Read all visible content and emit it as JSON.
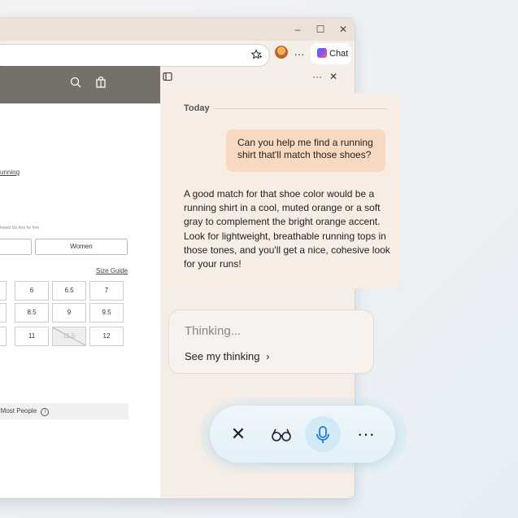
{
  "window": {
    "controls": {
      "minimize": "–",
      "maximize": "☐",
      "close": "✕"
    }
  },
  "toolbar": {
    "more": "···",
    "chat_label": "Chat"
  },
  "site": {
    "texts": {
      "running_link": "unning",
      "small_note": "lowed Sis Ans for free",
      "women_tab": "Women",
      "size_guide": "Size Guide",
      "see_bar": "e Most People"
    },
    "sizes": [
      [
        "",
        "6",
        "6.5",
        "7"
      ],
      [
        "",
        "8.5",
        "9",
        "9.5"
      ],
      [
        "5",
        "11",
        "11.5",
        "12"
      ]
    ],
    "unavailable_size": "11.5"
  },
  "panel": {
    "more": "···",
    "close": "✕",
    "today_label": "Today",
    "user_message": "Can you help me find a running shirt that'll match those shoes?",
    "assistant_message": "A good match for that shoe color would be a running shirt in a cool, muted orange or a soft gray to complement the bright orange accent. Look for lightweight, breathable running tops in those tones, and you'll get a nice, cohesive look for your runs!",
    "thinking_label": "Thinking...",
    "see_thinking_label": "See my thinking",
    "see_thinking_chevron": "›"
  },
  "voice": {
    "close": "✕",
    "more": "···"
  },
  "colors": {
    "accent_orange": "#fad9c1",
    "mic_blue": "#1a73d9",
    "header_gray": "#76706b"
  }
}
